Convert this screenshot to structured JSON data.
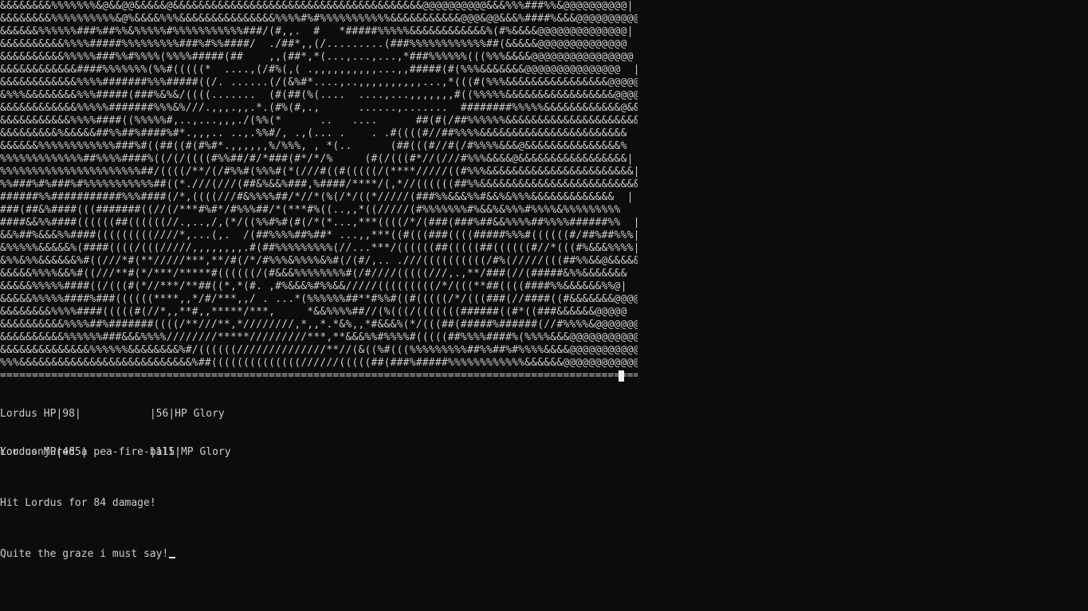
{
  "ascii_art_lines": [
    "&&&&&&&&%%%%%%%&@&&@@&&&&&@&&&&&&&&&&&&&&&&&&&&&&&&&&&&&&&&&&&&&&&@@@@@@@@@@&&&%%%###%%&@@@@@@@@@@|",
    "&&&&&&&&%%%%%%%%%%&@%&&&&%%%&&&&&&&&&&&&&&&%%%%#%#%%%%%%%%%%%&&&&&&&&&&&@@@&@@&&&%####%&&&@@@@@@@@@@|",
    "&&&&&&%%%%%%###%##%%&%%%%%#%%%%%%%%%%%###/(#,,.  #   *#####%%%%%&&&&&&&&&&&&%(#%&&&&@@@@@@@@@@@@@@|",
    "&&&&&&&&&&%%%%#####%%%%%%%%%###%#%%####/  ./##*,,(/.........(###%%%%%%%%%%%%##(&&&&&@@@@@@@@@@@@@@  |",
    "&&&&&&&&&&%%%%%###%%#%%%%(%%%%#####(##    ,,(##*,*(...,...,...,*###%%%%%%(((%%%&&&&@@@@@@@@@@@@@@@@ |",
    "&&&&&&&&&&&&####%%%%%%%(%%#(((((*  ....,(/#%(,( .,,,,,,,,,,...,,#####(#(%%%&&&&&&&@@@@@@@@@@@@@@@  |",
    "&&&&&&&&&&&&%%%%#######%%%#####((/. ......(/(&%#*....,..,,,,,,,,,,...,*(((#(%%%&&&&&&&&&&&&&&&&@@@@@@@@|",
    "&%%%&&&&&&&&%%%#####(###%&%&/((((.......  (#(##(%(....  ....,...,,,,,,,#((%%%%%&&&&&&&&&&&&&&&&&@@@@@@|",
    "&&&&&&&&&&&&%%%%%#######%%%&%///.,,,.,,.*.(#%(#,.,      ......,.......  ########%%%%%&&&&&&&&&&&&@&&&&&|",
    "&&&&&&&&&&&%%%%####((%%%%%#,..,...,,,./(%%(*      ..   ....      ##(#(/##%%%%%%&&&&&&&&&&&&&&&&&&&&&|",
    "&&&&&&&&&%&&&&&##%%##%####%#*.,,,.. ..,.%%#/, .,(... .    . .#((((#//##%%%%&&&&&&&&&&&&&&&&&&&&&&&  |",
    "&&&&&&%%%%%%%%%%%%###%#((##((#(#%#*.,,,,,,%/%%%, , *(..      (##(((#//#(/#%%%%&&&@&&&&&&&&&&&&&&&%  |",
    "%%%%%%%%%%%%%##%%%%####%((/(/((((#%%##/#/*###(#*/*/%     (#(/(((#*//(///#%%%&&&&@&&&&&&&&&&&&&&&&&|",
    "%%%%%%%%%%%%%%%%%%%%%%##/((((/**/(/#%%#(%%%#(*(///#((#(((((/(****/////((#%%%&&&&&&&&&&&&&&&&&&&&&&&|",
    "%%###%#%###%#%%%%%%%%%%%##((*.///(///(##&%&&%###,%####/****/(,*//((((((##%%&&&&&&&&&&&&&&&&&&&&&&&&&|",
    "######%%###########%%%####(/*,((((///#&%%%%##/*//*(%(/*/((*/////(###%%&&&%%#&&%&%%%&&&&&&&&&&&&&  |",
    "###(##&%####(((#######((//(/***#%#*/#%%%##/*(***#%((..,,*((/////(#%%%%%%%#%&&%&%%%#%%%%&%%%%%%%%%   |",
    "####&&%%####((((((##((((((//.,..,/,(*/((%%#%#(#(/*(*...,***((((/*/(###(###%##&&%%%%##%%%%######%%  |",
    "&&%##%&&&%%####(((((((((////*,...(,.  /(##%%%%##%##* ...,,***((#(((###((((#####%%%#((((((#/##%##%%%|",
    "&%%%%%&&&&&%(####((((/(((/////,,,,,,,,.#(##%%%%%%%%%(//...***/((((((##(((((##((((((#//*(((#%&&&%%%%|",
    "&%%&%%&&&&&&%#((///*#(**/////***,**/#(/*/#%%%&%%%%&%#(/(#/,.. .///((((((((((/#%(/////(((##%%&&@&&&&&|",
    "&&&&&%%%%&&%#((///**#(*/***/*****#((((((/(#&&&%%%%%%%%#(/#////(((((///,.,**/###(//(#####&%%&&&&&&&  |",
    "&&&&&%%%%%####((/(((#(*//***/**##((*,*(#. ,#%&&&%#%%&&/////(((((((((/*/(((**##((((####%%&&&&&&%%@|",
    "&&&&&%%%%%####%###((((((****,,*/#/***,,/ . ...*(%%%%%%##**#%%#((#(((((/*/(((###(//####((#&&&&&&&@@@@|",
    "&&&&&&&&%%%%####(((((#(//*,,**#,,*****/***,     *&&%%%%##//(%(((/(((((((######((#*((###&&&&&&@@@@@  |",
    "&&&&&&&&&&%%%%##%#######((((/**///**,*////////,*,,*.*&%,,*#&&&%(*/(((##(#####%######(//#%%%%&@@@@@@@@@|",
    "&&&&&&&&&&%%%%%%###&&&%%%%////////*****/////////***,**&&&%%#%%%%#(((((##%%%%####%(%%%%&&&@@@@@@@@@@@@|",
    "&&&&&&&&&&&&&&%%%%%%&&&&&&&&%#/((((((//////////////**//(&((%#(((%%%%%%%%%##%%##%#%%%%&&&&@@@@@@@@@@@@|",
    "%%%&&&&&&&&&&&&&&&&&&&&&&&&&&&%##((((((((((((((//////(((((##(###%#####%%%%%%%%%%%%&&&&&&@@@@@@@@@@@@|"
  ],
  "divider": "====================================================================================================",
  "hud": {
    "player_hp": "Lordus HP|98|           |56|HP Glory",
    "player_mp": "Lordus MP|485|          |115|MP Glory"
  },
  "messages": [
    "You conjured a pea-fire-ball!",
    "Hit Lordus for 84 damage!",
    "Quite the graze i must say!"
  ]
}
